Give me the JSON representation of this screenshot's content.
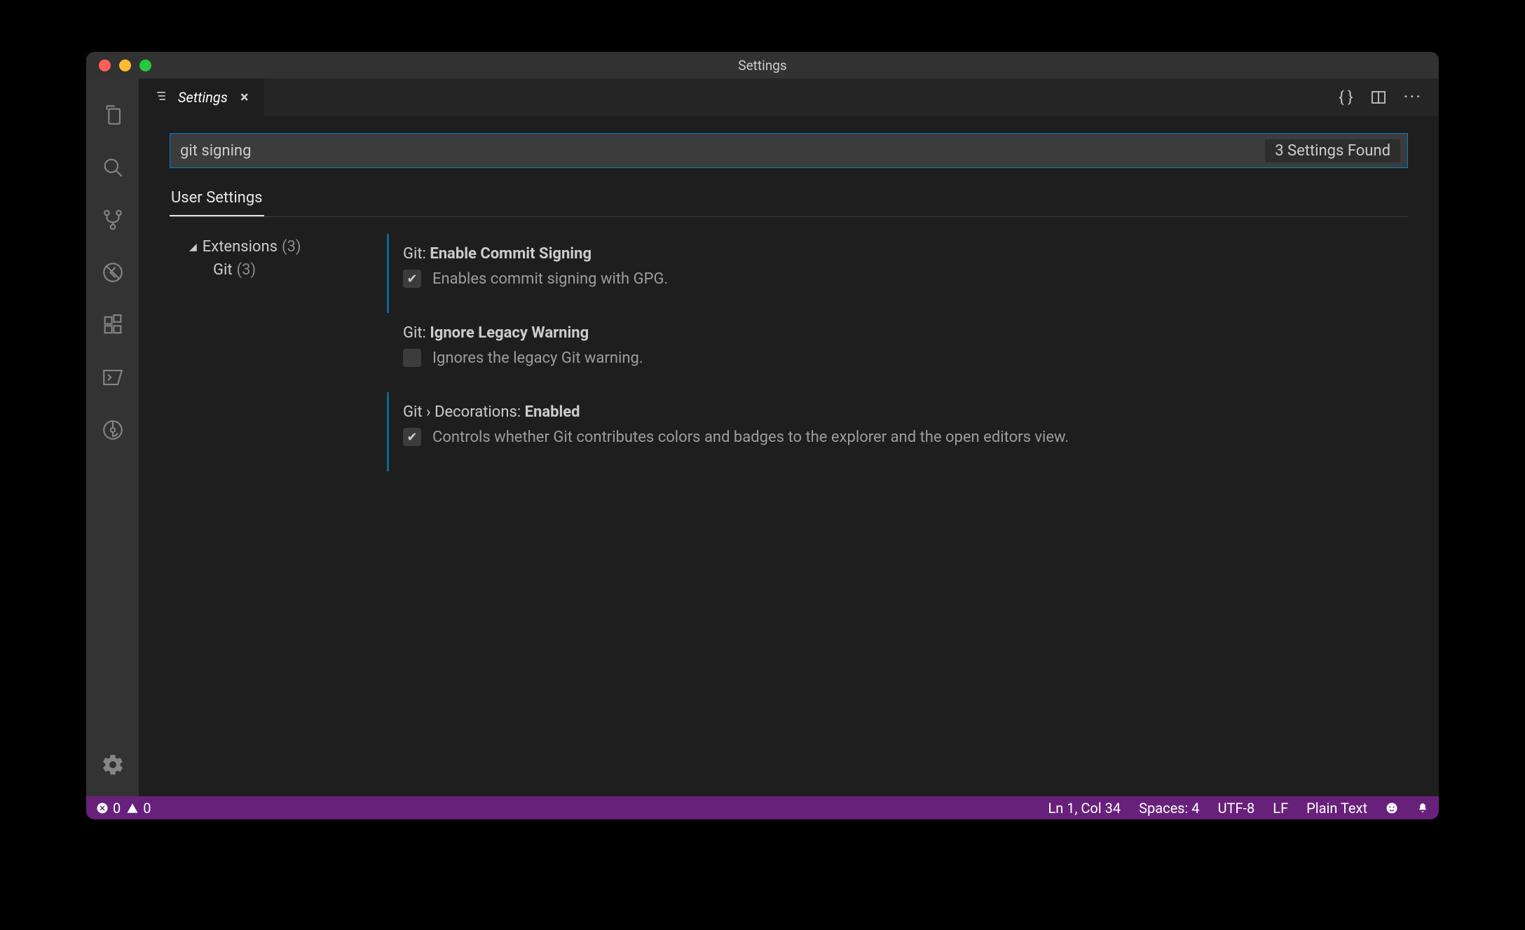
{
  "window": {
    "title": "Settings"
  },
  "tab": {
    "label": "Settings"
  },
  "search": {
    "value": "git signing",
    "result_count": "3 Settings Found"
  },
  "scopes": {
    "user": "User Settings"
  },
  "toc": {
    "group_label": "Extensions",
    "group_count": "(3)",
    "child_label": "Git",
    "child_count": "(3)"
  },
  "settings": [
    {
      "scope": "Git:",
      "name": "Enable Commit Signing",
      "desc": "Enables commit signing with GPG.",
      "checked": true,
      "modified": true
    },
    {
      "scope": "Git:",
      "name": "Ignore Legacy Warning",
      "desc": "Ignores the legacy Git warning.",
      "checked": false,
      "modified": false
    },
    {
      "scope": "Git",
      "crumb": " › Decorations: ",
      "name": "Enabled",
      "desc": "Controls whether Git contributes colors and badges to the explorer and the open editors view.",
      "checked": true,
      "modified": true
    }
  ],
  "statusbar": {
    "errors": "0",
    "warnings": "0",
    "cursor": "Ln 1, Col 34",
    "indent": "Spaces: 4",
    "encoding": "UTF-8",
    "eol": "LF",
    "language": "Plain Text"
  }
}
